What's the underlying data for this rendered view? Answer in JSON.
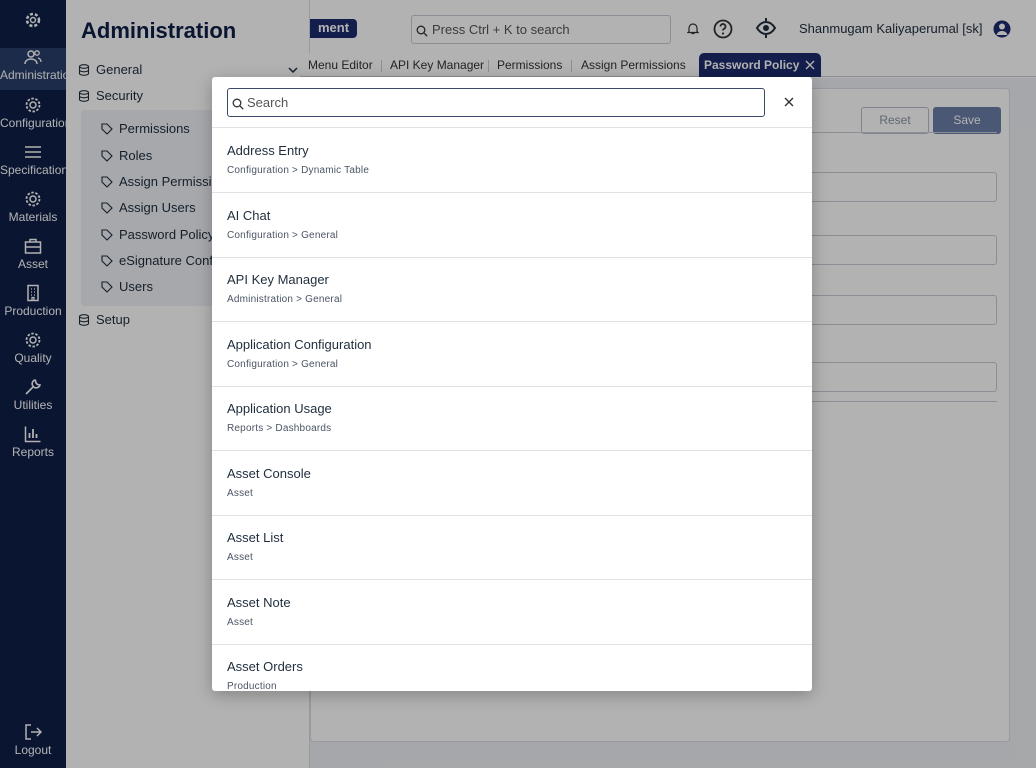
{
  "rail": {
    "items": [
      {
        "label": "Administration",
        "icon": "users-icon"
      },
      {
        "label": "Configuration",
        "icon": "gear-icon"
      },
      {
        "label": "Specifications",
        "icon": "list-icon"
      },
      {
        "label": "Materials",
        "icon": "gear-icon"
      },
      {
        "label": "Asset",
        "icon": "toolbox-icon"
      },
      {
        "label": "Production",
        "icon": "building-icon"
      },
      {
        "label": "Quality",
        "icon": "gear-icon"
      },
      {
        "label": "Utilities",
        "icon": "wrench-icon"
      },
      {
        "label": "Reports",
        "icon": "bar-chart-icon"
      }
    ],
    "logout_label": "Logout"
  },
  "panel": {
    "title": "Administration",
    "general_label": "General",
    "security_label": "Security",
    "setup_label": "Setup",
    "security_items": [
      {
        "label": "Permissions"
      },
      {
        "label": "Roles"
      },
      {
        "label": "Assign Permissions"
      },
      {
        "label": "Assign Users"
      },
      {
        "label": "Password Policy"
      },
      {
        "label": "eSignature Configuration"
      },
      {
        "label": "Users"
      }
    ]
  },
  "topbar": {
    "module_badge": "ment",
    "search_placeholder": "Press Ctrl + K to search",
    "user_name": "Shanmugam Kaliyaperumal [sk]"
  },
  "tabs": {
    "items": [
      {
        "label": "Menu Editor"
      },
      {
        "label": "API Key Manager"
      },
      {
        "label": "Permissions"
      },
      {
        "label": "Assign Permissions"
      }
    ],
    "active_label": "Password Policy"
  },
  "content": {
    "reset_label": "Reset",
    "save_label": "Save"
  },
  "dialog": {
    "search_placeholder": "Search",
    "results": [
      {
        "title": "Address Entry",
        "path": "Configuration > Dynamic Table"
      },
      {
        "title": "AI Chat",
        "path": "Configuration > General"
      },
      {
        "title": "API Key Manager",
        "path": "Administration > General"
      },
      {
        "title": "Application Configuration",
        "path": "Configuration > General"
      },
      {
        "title": "Application Usage",
        "path": "Reports > Dashboards"
      },
      {
        "title": "Asset Console",
        "path": "Asset"
      },
      {
        "title": "Asset List",
        "path": "Asset"
      },
      {
        "title": "Asset Note",
        "path": "Asset"
      },
      {
        "title": "Asset Orders",
        "path": "Production"
      }
    ]
  },
  "colors": {
    "rail_bg": "#0e1f47",
    "accent": "#1d2c6e",
    "overlay": "rgba(0,0,0,0.30)"
  }
}
